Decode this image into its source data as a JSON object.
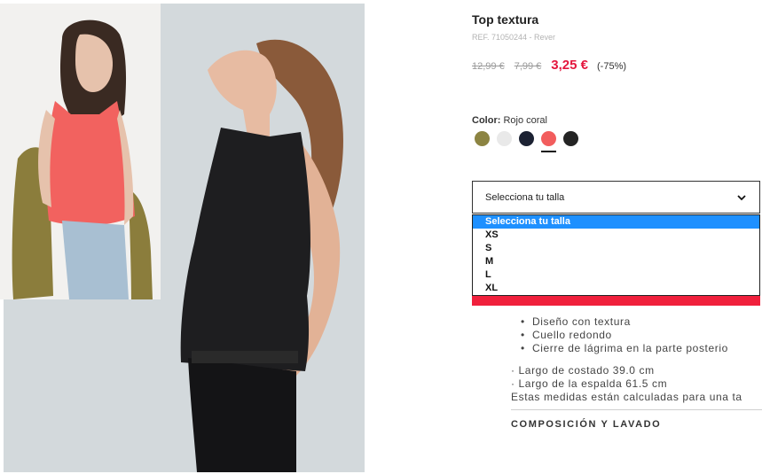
{
  "product": {
    "title": "Top textura",
    "ref": "REF. 71050244 - Rever"
  },
  "prices": {
    "original": "12,99 €",
    "previous": "7,99 €",
    "current": "3,25 €",
    "discount": "(-75%)"
  },
  "color": {
    "label": "Color:",
    "value": "Rojo coral",
    "swatches": [
      {
        "name": "khaki",
        "hex": "#8c8442"
      },
      {
        "name": "white",
        "hex": "#e9e9e9"
      },
      {
        "name": "navy",
        "hex": "#1c2233"
      },
      {
        "name": "coral",
        "hex": "#f25d5d"
      },
      {
        "name": "black",
        "hex": "#242424"
      }
    ],
    "selected_index": 3
  },
  "size": {
    "select_label": "Selecciona tu talla",
    "options": [
      "Selecciona tu talla",
      "XS",
      "S",
      "M",
      "L",
      "XL"
    ],
    "highlighted_index": 0
  },
  "features": [
    "Diseño con textura",
    "Cuello redondo",
    "Cierre de lágrima en la parte posterio"
  ],
  "measures": [
    "· Largo de costado 39.0 cm",
    "· Largo de la espalda 61.5 cm",
    "Estas medidas están calculadas para una ta"
  ],
  "composition_label": "COMPOSICIÓN Y LAVADO",
  "colors": {
    "accent_red": "#e4173e",
    "bar_red": "#f0203c",
    "dropdown_highlight": "#1e90ff"
  }
}
